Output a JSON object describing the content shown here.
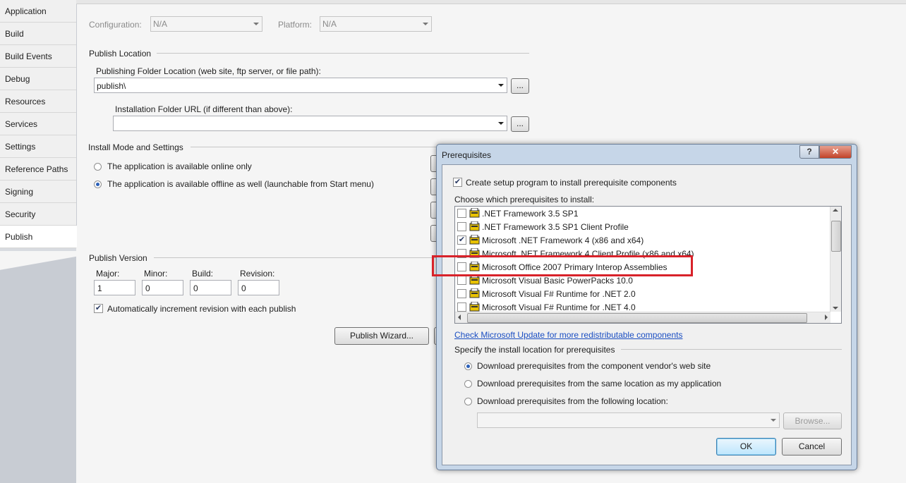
{
  "sidebar": {
    "items": [
      {
        "label": "Application"
      },
      {
        "label": "Build"
      },
      {
        "label": "Build Events"
      },
      {
        "label": "Debug"
      },
      {
        "label": "Resources"
      },
      {
        "label": "Services"
      },
      {
        "label": "Settings"
      },
      {
        "label": "Reference Paths"
      },
      {
        "label": "Signing"
      },
      {
        "label": "Security"
      },
      {
        "label": "Publish"
      }
    ],
    "active": "Publish"
  },
  "config": {
    "configuration_label": "Configuration:",
    "configuration_value": "N/A",
    "platform_label": "Platform:",
    "platform_value": "N/A"
  },
  "publish_location": {
    "section_title": "Publish Location",
    "folder_label": "Publishing Folder Location (web site, ftp server, or file path):",
    "folder_value": "publish\\",
    "browse_label": "...",
    "install_url_label": "Installation Folder URL (if different than above):",
    "install_url_value": ""
  },
  "install_mode": {
    "section_title": "Install Mode and Settings",
    "online_only": "The application is available online only",
    "offline": "The application is available offline as well (launchable from Start menu)",
    "selected": "offline"
  },
  "publish_version": {
    "section_title": "Publish Version",
    "major_label": "Major:",
    "major_value": "1",
    "minor_label": "Minor:",
    "minor_value": "0",
    "build_label": "Build:",
    "build_value": "0",
    "revision_label": "Revision:",
    "revision_value": "0",
    "auto_increment_label": "Automatically increment revision with each publish",
    "auto_increment_checked": true,
    "wizard_button": "Publish Wizard..."
  },
  "dialog": {
    "title": "Prerequisites",
    "help_glyph": "?",
    "close_glyph": "✕",
    "create_setup_label": "Create setup program to install prerequisite components",
    "create_setup_checked": true,
    "choose_label": "Choose which prerequisites to install:",
    "prerequisites": [
      {
        "label": ".NET Framework 3.5 SP1",
        "checked": false
      },
      {
        "label": ".NET Framework 3.5 SP1 Client Profile",
        "checked": false
      },
      {
        "label": "Microsoft .NET Framework 4 (x86 and x64)",
        "checked": true
      },
      {
        "label": "Microsoft .NET Framework 4 Client Profile (x86 and x64)",
        "checked": false
      },
      {
        "label": "Microsoft Office 2007 Primary Interop Assemblies",
        "checked": false
      },
      {
        "label": "Microsoft Visual Basic PowerPacks 10.0",
        "checked": false
      },
      {
        "label": "Microsoft Visual F# Runtime for .NET 2.0",
        "checked": false
      },
      {
        "label": "Microsoft Visual F# Runtime for .NET 4.0",
        "checked": false
      }
    ],
    "update_link": "Check Microsoft Update for more redistributable components",
    "location_section": "Specify the install location for prerequisites",
    "location_vendor": "Download prerequisites from the component vendor's web site",
    "location_same": "Download prerequisites from the same location as my application",
    "location_custom": "Download prerequisites from the following location:",
    "location_selected": "vendor",
    "browse_button": "Browse...",
    "ok_button": "OK",
    "cancel_button": "Cancel"
  },
  "colors": {
    "highlight": "#d8222a",
    "link": "#1a4ec2"
  }
}
